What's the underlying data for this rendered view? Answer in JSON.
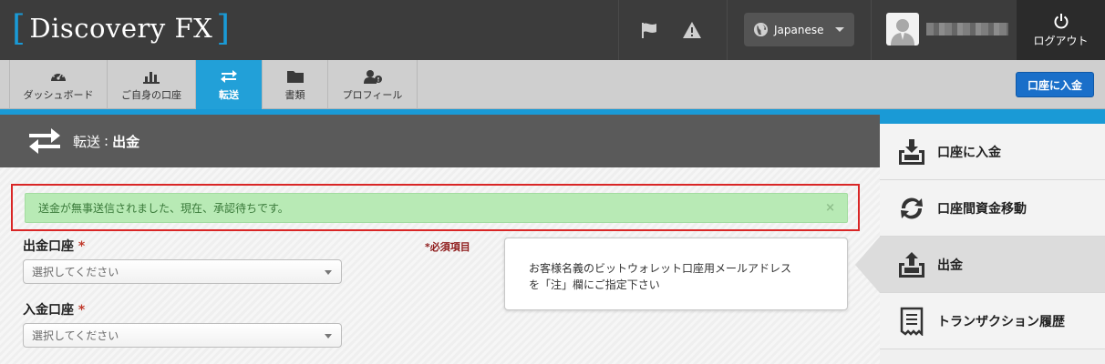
{
  "header": {
    "logo_text": "Discovery FX",
    "logo_bracket_left": "[",
    "logo_bracket_right": "]",
    "language": "Japanese",
    "logout_label": "ログアウト",
    "brand_color": "#1a9ad6"
  },
  "tabs": [
    {
      "label": "ダッシュボード",
      "icon": "dashboard-icon"
    },
    {
      "label": "ご自身の口座",
      "icon": "bar-chart-icon"
    },
    {
      "label": "転送",
      "icon": "transfer-icon",
      "active": true
    },
    {
      "label": "書類",
      "icon": "folder-icon"
    },
    {
      "label": "プロフィール",
      "icon": "profile-icon"
    }
  ],
  "deposit_button": "口座に入金",
  "page_title": {
    "section": "転送",
    "separator": ":",
    "page": "出金"
  },
  "alert": {
    "message": "送金が無事送信されました、現在、承認待ちです。",
    "close": "×",
    "color": "#b8eab5"
  },
  "form": {
    "required_note": "*必須項目",
    "from_account": {
      "label": "出金口座",
      "required_mark": "*",
      "placeholder": "選択してください"
    },
    "to_account": {
      "label": "入金口座",
      "required_mark": "*",
      "placeholder": "選択してください"
    }
  },
  "tooltip": {
    "line1": "お客様名義のビットウォレット口座用メールアドレス",
    "line2": "を「注」欄にご指定下さい"
  },
  "side_nav": [
    {
      "label": "口座に入金",
      "icon": "deposit-tray-icon"
    },
    {
      "label": "口座間資金移動",
      "icon": "sync-arrows-icon"
    },
    {
      "label": "出金",
      "icon": "withdraw-tray-icon",
      "active": true
    },
    {
      "label": "トランザクション履歴",
      "icon": "receipt-icon"
    }
  ]
}
